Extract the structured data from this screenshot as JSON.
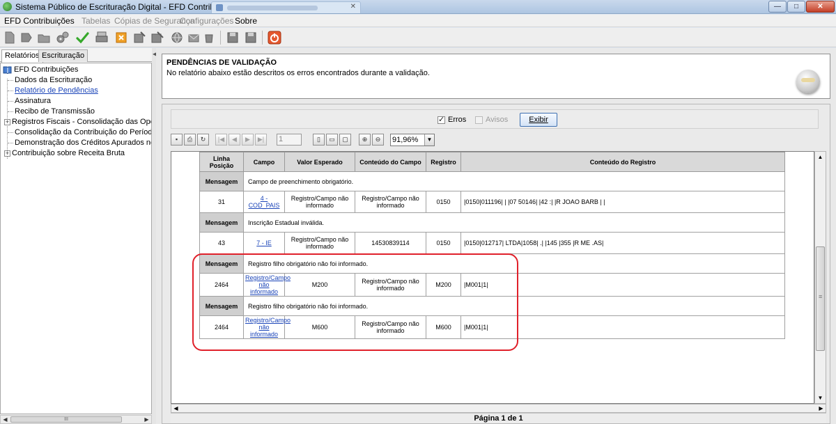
{
  "window": {
    "title": "Sistema Público de Escrituração Digital - EFD Contribuições",
    "minimize": "—",
    "maximize": "□",
    "close": "✕"
  },
  "menu": [
    {
      "label": "EFD Contribuições",
      "enabled": true
    },
    {
      "label": "Tabelas",
      "enabled": false
    },
    {
      "label": "Cópias de Segurança",
      "enabled": false
    },
    {
      "label": "Configurações",
      "enabled": false
    },
    {
      "label": "Sobre",
      "enabled": true
    }
  ],
  "left_tabs": [
    "Relatórios",
    "Escrituração"
  ],
  "tree": {
    "root": "EFD Contribuições",
    "items": [
      {
        "label": "Dados da Escrituração",
        "expandable": false,
        "link": false
      },
      {
        "label": "Relatório de Pendências",
        "expandable": false,
        "link": true
      },
      {
        "label": "Assinatura",
        "expandable": false,
        "link": false
      },
      {
        "label": "Recibo de Transmissão",
        "expandable": false,
        "link": false
      },
      {
        "label": "Registros Fiscais - Consolidação das Operaçõ",
        "expandable": true,
        "link": false
      },
      {
        "label": "Consolidação da Contribuição do Período",
        "expandable": false,
        "link": false
      },
      {
        "label": "Demonstração dos Créditos Apurados no Perío",
        "expandable": false,
        "link": false
      },
      {
        "label": "Contribuição sobre Receita Bruta",
        "expandable": true,
        "link": false
      }
    ]
  },
  "header": {
    "title": "PENDÊNCIAS DE VALIDAÇÃO",
    "description": "No relatório abaixo estão descritos os erros encontrados durante a validação."
  },
  "filter": {
    "erros_label": "Erros",
    "erros_checked": true,
    "avisos_label": "Avisos",
    "avisos_checked": false,
    "button_label": "Exibir"
  },
  "viewer": {
    "page_value": "1",
    "zoom": "91,96%"
  },
  "table": {
    "headers": [
      "Linha Posição",
      "Campo",
      "Valor Esperado",
      "Conteúdo do Campo",
      "Registro",
      "Conteúdo do Registro"
    ],
    "message_label": "Mensagem",
    "groups": [
      {
        "message": "Campo de preenchimento obrigatório.",
        "row": {
          "linha": "31",
          "campo": "4 - COD_PAIS",
          "valor": "Registro/Campo não informado",
          "conteudo_campo": "Registro/Campo não informado",
          "registro": "0150",
          "conteudo_registro": "|0150|011196|                                        | |07          50146| |42     :| |R JOAO BARB              |                                  |"
        }
      },
      {
        "message": "Inscrição Estadual inválida.",
        "row": {
          "linha": "43",
          "campo": "7 - IE",
          "valor": "Registro/Campo não informado",
          "conteudo_campo": "14530839114",
          "registro": "0150",
          "conteudo_registro": "|0150|012717|                   LTDA|1058|        .| |145     |355     |R ME            .AS|"
        }
      },
      {
        "message": "Registro filho obrigatório não foi informado.",
        "row": {
          "linha": "2464",
          "campo": "Registro/Campo não informado",
          "valor": "M200",
          "conteudo_campo": "Registro/Campo não informado",
          "registro": "M200",
          "conteudo_registro": "|M001|1|"
        }
      },
      {
        "message": "Registro filho obrigatório não foi informado.",
        "row": {
          "linha": "2464",
          "campo": "Registro/Campo não informado",
          "valor": "M600",
          "conteudo_campo": "Registro/Campo não informado",
          "registro": "M600",
          "conteudo_registro": "|M001|1|"
        }
      }
    ]
  },
  "footer": {
    "page_label": "Página 1 de 1"
  },
  "colors": {
    "highlight": "#e0202a",
    "link": "#1a44b8"
  }
}
